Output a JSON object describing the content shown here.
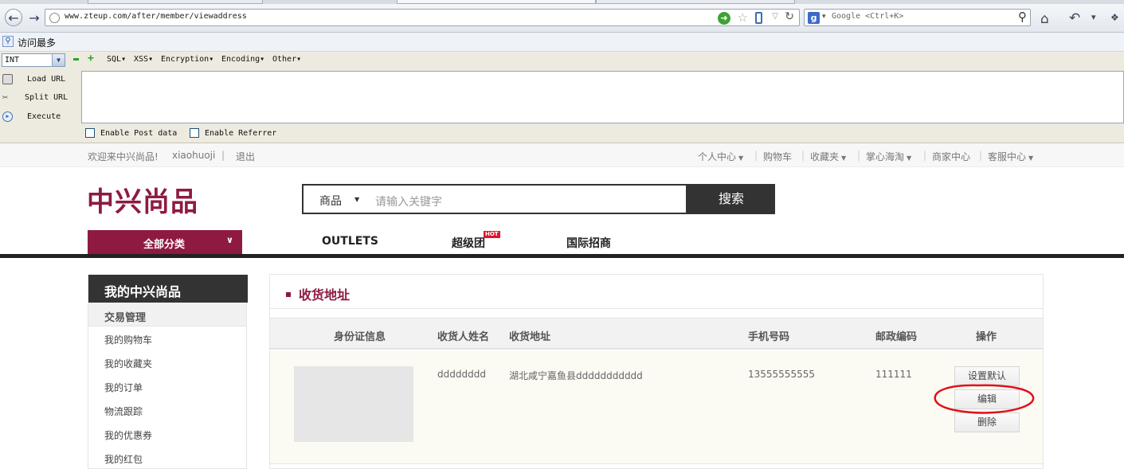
{
  "browser": {
    "url": "www.zteup.com/after/member/viewaddress",
    "search_placeholder": "Google <Ctrl+K>",
    "bookmarks": {
      "most_visited": "访问最多"
    }
  },
  "hackbar": {
    "select_value": "INT",
    "menus": [
      "SQL",
      "XSS",
      "Encryption",
      "Encoding",
      "Other"
    ],
    "load_url": "Load URL",
    "split_url": "Split URL",
    "execute": "Execute",
    "enable_post": "Enable Post data",
    "enable_referrer": "Enable Referrer"
  },
  "site": {
    "welcome": "欢迎来中兴尚品!",
    "username": "xiaohuoji",
    "separator": "|",
    "logout": "退出",
    "top_nav": [
      {
        "label": "个人中心",
        "caret": true
      },
      {
        "label": "购物车",
        "caret": false
      },
      {
        "label": "收藏夹",
        "caret": true
      },
      {
        "label": "掌心海淘",
        "caret": true
      },
      {
        "label": "商家中心",
        "caret": false
      },
      {
        "label": "客服中心",
        "caret": true
      }
    ],
    "logo": "中兴尚品",
    "search": {
      "category": "商品",
      "placeholder": "请输入关键字",
      "button": "搜索"
    },
    "all_categories": "全部分类",
    "main_nav": [
      "OUTLETS",
      "超级团",
      "国际招商"
    ],
    "hot_badge": "HOT"
  },
  "sidebar": {
    "title": "我的中兴尚品",
    "section": "交易管理",
    "links": [
      "我的购物车",
      "我的收藏夹",
      "我的订单",
      "物流跟踪",
      "我的优惠券",
      "我的红包"
    ]
  },
  "address_panel": {
    "title": "收货地址",
    "columns": [
      "身份证信息",
      "收货人姓名",
      "收货地址",
      "手机号码",
      "邮政编码",
      "操作"
    ],
    "row": {
      "name": "dddddddd",
      "address": "湖北咸宁嘉鱼县ddddddddddd",
      "phone": "13555555555",
      "zip": "111111"
    },
    "actions": [
      "设置默认",
      "编辑",
      "删除"
    ]
  },
  "colors": {
    "brand": "#8e1a42",
    "dark": "#333333",
    "annotation": "#e0101a",
    "hot": "#e0142d"
  }
}
